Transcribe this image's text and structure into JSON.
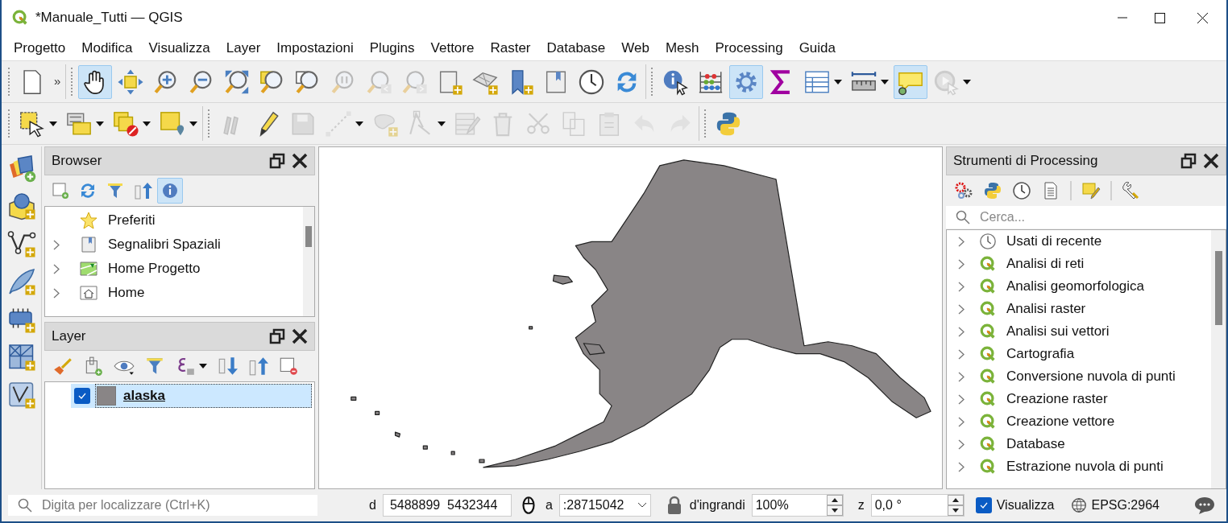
{
  "window": {
    "title": "*Manuale_Tutti — QGIS"
  },
  "menu": [
    "Progetto",
    "Modifica",
    "Visualizza",
    "Layer",
    "Impostazioni",
    "Plugins",
    "Vettore",
    "Raster",
    "Database",
    "Web",
    "Mesh",
    "Processing",
    "Guida"
  ],
  "toolbar_rows": [
    [
      {
        "kind": "file",
        "selected": false,
        "disabled": false
      },
      {
        "kind": "overflow",
        "text": "»"
      },
      {
        "kind": "separator"
      },
      {
        "kind": "hand",
        "selected": true,
        "disabled": false
      },
      {
        "kind": "move",
        "selected": false,
        "disabled": false
      },
      {
        "kind": "zoomin",
        "selected": false,
        "disabled": false
      },
      {
        "kind": "zoomout",
        "selected": false,
        "disabled": false
      },
      {
        "kind": "zoomfull",
        "selected": false,
        "disabled": false
      },
      {
        "kind": "zoomlayer",
        "selected": false,
        "disabled": false
      },
      {
        "kind": "zoomsel",
        "selected": false,
        "disabled": false
      },
      {
        "kind": "zoomnative",
        "selected": false,
        "disabled": true
      },
      {
        "kind": "zoomlast",
        "selected": false,
        "disabled": true
      },
      {
        "kind": "zoomnext",
        "selected": false,
        "disabled": true
      },
      {
        "kind": "mapview",
        "selected": false,
        "disabled": false
      },
      {
        "kind": "map3d",
        "selected": false,
        "disabled": false
      },
      {
        "kind": "bookmarknew",
        "selected": false,
        "disabled": false
      },
      {
        "kind": "bookmarks",
        "selected": false,
        "disabled": false
      },
      {
        "kind": "clock",
        "selected": false,
        "disabled": false
      },
      {
        "kind": "refresh",
        "selected": false,
        "disabled": false
      },
      {
        "kind": "separator"
      },
      {
        "kind": "identify",
        "selected": false,
        "disabled": false
      },
      {
        "kind": "abacus",
        "selected": false,
        "disabled": false
      },
      {
        "kind": "gear",
        "selected": true,
        "disabled": false
      },
      {
        "kind": "sigma",
        "selected": false,
        "disabled": false
      },
      {
        "kind": "table",
        "selected": false,
        "disabled": false,
        "dropdown": true
      },
      {
        "kind": "ruler",
        "selected": false,
        "disabled": false,
        "dropdown": true
      },
      {
        "kind": "tip",
        "selected": true,
        "disabled": false
      },
      {
        "kind": "action",
        "selected": false,
        "disabled": true,
        "dropdown": true
      }
    ],
    [
      {
        "kind": "select",
        "selected": false,
        "disabled": false,
        "dropdown": true
      },
      {
        "kind": "selattr",
        "selected": false,
        "disabled": false,
        "dropdown": true
      },
      {
        "kind": "deselect",
        "selected": false,
        "disabled": false,
        "dropdown": true
      },
      {
        "kind": "selloc",
        "selected": false,
        "disabled": false,
        "dropdown": true
      },
      {
        "kind": "separator"
      },
      {
        "kind": "editmulti",
        "selected": false,
        "disabled": true
      },
      {
        "kind": "pencil",
        "selected": false,
        "disabled": false
      },
      {
        "kind": "save",
        "selected": false,
        "disabled": true
      },
      {
        "kind": "digitize",
        "selected": false,
        "disabled": true,
        "dropdown": true
      },
      {
        "kind": "polygon",
        "selected": false,
        "disabled": true
      },
      {
        "kind": "vertex",
        "selected": false,
        "disabled": true,
        "dropdown": true
      },
      {
        "kind": "tableedit",
        "selected": false,
        "disabled": true
      },
      {
        "kind": "delete",
        "selected": false,
        "disabled": true
      },
      {
        "kind": "cut",
        "selected": false,
        "disabled": true
      },
      {
        "kind": "copy",
        "selected": false,
        "disabled": true
      },
      {
        "kind": "paste",
        "selected": false,
        "disabled": true
      },
      {
        "kind": "undo",
        "selected": false,
        "disabled": true
      },
      {
        "kind": "redo",
        "selected": false,
        "disabled": true
      },
      {
        "kind": "separator"
      },
      {
        "kind": "python",
        "selected": false,
        "disabled": false
      }
    ]
  ],
  "side_toolbar": [
    {
      "kind": "layers"
    },
    {
      "kind": "globebox"
    },
    {
      "kind": "vectorline"
    },
    {
      "kind": "feather"
    },
    {
      "kind": "chip"
    },
    {
      "kind": "mesh"
    },
    {
      "kind": "vframe"
    }
  ],
  "browser": {
    "title": "Browser",
    "tools": [
      {
        "kind": "newlayer",
        "selected": false
      },
      {
        "kind": "refresh",
        "selected": false
      },
      {
        "kind": "filter",
        "selected": false
      },
      {
        "kind": "collapse",
        "selected": false
      },
      {
        "kind": "info",
        "selected": true
      }
    ],
    "items": [
      {
        "label": "Preferiti",
        "kind": "star",
        "expandable": false
      },
      {
        "label": "Segnalibri Spaziali",
        "kind": "bookmarks",
        "expandable": true
      },
      {
        "label": "Home Progetto",
        "kind": "homeproject",
        "expandable": true
      },
      {
        "label": "Home",
        "kind": "home",
        "expandable": true
      }
    ]
  },
  "layers": {
    "title": "Layer",
    "tools": [
      {
        "kind": "style"
      },
      {
        "kind": "addgroup"
      },
      {
        "kind": "eye"
      },
      {
        "kind": "filter"
      },
      {
        "kind": "expr",
        "dropdown": true
      },
      {
        "kind": "expand"
      },
      {
        "kind": "collapse"
      },
      {
        "kind": "remove"
      }
    ],
    "items": [
      {
        "name": "alaska",
        "checked": true,
        "selected": true
      }
    ]
  },
  "map": {
    "kind": "alaska"
  },
  "processing": {
    "title": "Strumenti di Processing",
    "tools": [
      {
        "kind": "models"
      },
      {
        "kind": "python"
      },
      {
        "kind": "clock"
      },
      {
        "kind": "doc"
      },
      {
        "kind": "separator"
      },
      {
        "kind": "editsel"
      },
      {
        "kind": "separator"
      },
      {
        "kind": "wrench"
      }
    ],
    "search": {
      "placeholder": "Cerca..."
    },
    "items": [
      {
        "label": "Usati di recente",
        "kind": "recent"
      },
      {
        "label": "Analisi di reti",
        "kind": "provider"
      },
      {
        "label": "Analisi geomorfologica",
        "kind": "provider"
      },
      {
        "label": "Analisi raster",
        "kind": "provider"
      },
      {
        "label": "Analisi sui vettori",
        "kind": "provider"
      },
      {
        "label": "Cartografia",
        "kind": "provider"
      },
      {
        "label": "Conversione nuvola di punti",
        "kind": "provider"
      },
      {
        "label": "Creazione raster",
        "kind": "provider"
      },
      {
        "label": "Creazione vettore",
        "kind": "provider"
      },
      {
        "label": "Database",
        "kind": "provider"
      },
      {
        "label": "Estrazione nuvola di punti",
        "kind": "provider"
      }
    ]
  },
  "status_bar": {
    "locator": {
      "placeholder": "Digita per localizzare (Ctrl+K)"
    },
    "coordinate_label": "d",
    "coordinate": "5488899  5432344",
    "scale_label": "a",
    "scale": ":28715042",
    "magnifier_label": "d'ingrandi",
    "magnifier": "100%",
    "rotation_label": "z",
    "rotation": "0,0 °",
    "render": {
      "label": "Visualizza",
      "checked": true
    },
    "crs": "EPSG:2964"
  }
}
